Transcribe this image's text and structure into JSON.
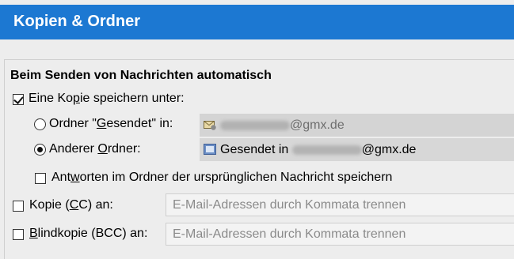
{
  "header": {
    "title": "Kopien & Ordner"
  },
  "section": {
    "title": "Beim Senden von Nachrichten automatisch"
  },
  "save_copy": {
    "label_pre": "Eine Ko",
    "label_accel": "p",
    "label_post": "ie speichern unter:",
    "checked": true
  },
  "folder_sent": {
    "label_pre": "Ordner \"",
    "label_accel": "G",
    "label_post": "esendet\" in:",
    "selected": false,
    "value_suffix": "@gmx.de",
    "icon": "account-icon"
  },
  "folder_other": {
    "label_pre": "Anderer ",
    "label_accel": "O",
    "label_post": "rdner:",
    "selected": true,
    "value_prefix": "Gesendet in ",
    "value_suffix": "@gmx.de",
    "icon": "folder-icon"
  },
  "replies": {
    "label_pre": "Ant",
    "label_accel": "w",
    "label_post": "orten im Ordner der ursprünglichen Nachricht speichern",
    "checked": false
  },
  "cc": {
    "label_pre": "Kopie (",
    "label_accel": "C",
    "label_post": "C) an:",
    "checked": false,
    "placeholder": "E-Mail-Adressen durch Kommata trennen"
  },
  "bcc": {
    "label_pre": "",
    "label_accel": "B",
    "label_post": "lindkopie (BCC) an:",
    "checked": false,
    "placeholder": "E-Mail-Adressen durch Kommata trennen"
  },
  "colors": {
    "header_bg": "#1c78d2",
    "window_bg": "#ededed"
  }
}
